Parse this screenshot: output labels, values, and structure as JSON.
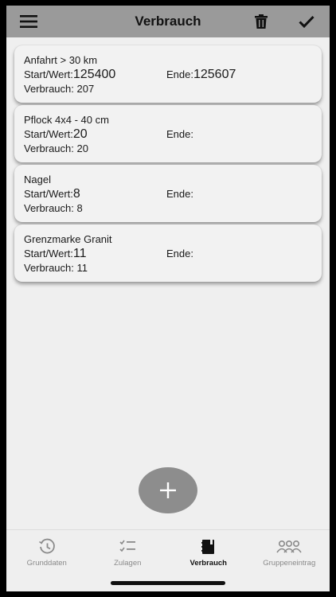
{
  "header": {
    "title": "Verbrauch",
    "menu_icon": "hamburger-icon",
    "delete_icon": "trash-icon",
    "confirm_icon": "checkmark-icon"
  },
  "items": [
    {
      "name": "Anfahrt > 30 km",
      "start_label": "Start/Wert:",
      "start_value": "125400",
      "ende_label": "Ende:",
      "ende_value": "125607",
      "verbrauch_label": "Verbrauch:",
      "verbrauch_value": "207"
    },
    {
      "name": "Pflock 4x4 - 40 cm",
      "start_label": "Start/Wert:",
      "start_value": "20",
      "ende_label": "Ende:",
      "ende_value": "",
      "verbrauch_label": "Verbrauch:",
      "verbrauch_value": "20"
    },
    {
      "name": "Nagel",
      "start_label": "Start/Wert:",
      "start_value": "8",
      "ende_label": "Ende:",
      "ende_value": "",
      "verbrauch_label": "Verbrauch:",
      "verbrauch_value": "8"
    },
    {
      "name": "Grenzmarke Granit",
      "start_label": "Start/Wert:",
      "start_value": "11",
      "ende_label": "Ende:",
      "ende_value": "",
      "verbrauch_label": "Verbrauch:",
      "verbrauch_value": "11"
    }
  ],
  "fab": {
    "icon": "plus-icon"
  },
  "tabs": [
    {
      "label": "Grunddaten",
      "icon": "history-clock-icon",
      "active": false
    },
    {
      "label": "Zulagen",
      "icon": "checklist-icon",
      "active": false
    },
    {
      "label": "Verbrauch",
      "icon": "book-icon",
      "active": true
    },
    {
      "label": "Gruppeneintrag",
      "icon": "group-icon",
      "active": false
    }
  ],
  "colors": {
    "header_bg": "#9a9a9a",
    "screen_bg": "#efefef",
    "fab_bg": "#8d8d8d"
  }
}
